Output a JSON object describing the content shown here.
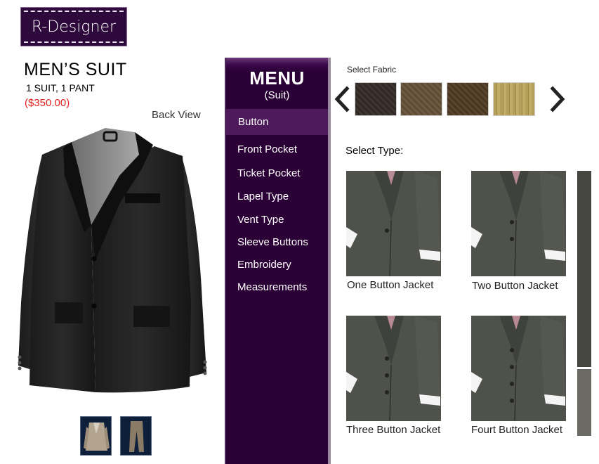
{
  "logo": {
    "text": "R-Designer"
  },
  "product": {
    "title": "MEN’S SUIT",
    "subtitle": "1 SUIT, 1 PANT",
    "price": "($350.00)",
    "back_view_label": "Back View"
  },
  "menu": {
    "title": "MENU",
    "subtitle": "(Suit)",
    "items": [
      {
        "label": "Button",
        "active": true
      },
      {
        "label": "Front Pocket"
      },
      {
        "label": "Ticket Pocket"
      },
      {
        "label": "Lapel Type"
      },
      {
        "label": "Vent Type"
      },
      {
        "label": "Sleeve Buttons"
      },
      {
        "label": "Embroidery"
      },
      {
        "label": "Measurements"
      }
    ]
  },
  "fabric": {
    "label": "Select Fabric",
    "swatches": [
      "dark-brown-tweed",
      "brown",
      "chocolate-brown",
      "khaki-pinstripe"
    ]
  },
  "type": {
    "label": "Select Type:",
    "options": [
      {
        "label": "One Button Jacket",
        "buttons": 1
      },
      {
        "label": "Two Button Jacket",
        "buttons": 2
      },
      {
        "label": "Three Button Jacket",
        "buttons": 3
      },
      {
        "label": "Fourt Button Jacket",
        "buttons": 4
      }
    ]
  },
  "colors": {
    "brand_purple": "#2a0036",
    "menu_active": "#4e1a5c",
    "price_red": "#e0231f",
    "jacket_gray": "#4f524b"
  }
}
